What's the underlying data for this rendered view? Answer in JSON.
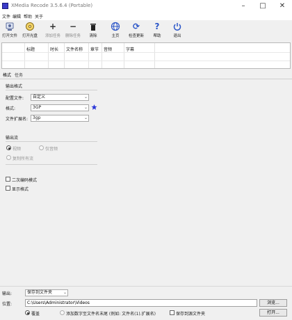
{
  "window": {
    "title": "XMedia Recode 3.5.6.4 (Portable)",
    "minimize": "–",
    "maximize": "□",
    "close": "✕"
  },
  "menu": [
    "文件",
    "编辑",
    "帮助",
    "关于"
  ],
  "toolbar": [
    {
      "label": "打开文件",
      "icon": "open-file-icon",
      "enabled": true
    },
    {
      "label": "打开光盘",
      "icon": "open-disc-icon",
      "enabled": true
    },
    {
      "label": "添加任务",
      "icon": "add-icon",
      "enabled": false
    },
    {
      "label": "删除任务",
      "icon": "remove-icon",
      "enabled": false
    },
    {
      "label": "清除",
      "icon": "trash-icon",
      "enabled": true
    },
    {
      "label": "主页",
      "icon": "globe-icon",
      "enabled": true
    },
    {
      "label": "检查更新",
      "icon": "refresh-icon",
      "enabled": true
    },
    {
      "label": "帮助",
      "icon": "help-icon",
      "enabled": true
    },
    {
      "label": "退出",
      "icon": "power-icon",
      "enabled": true
    }
  ],
  "file_list": {
    "columns": [
      "标题",
      "时长",
      "文件名称",
      "章节",
      "音频",
      "字幕"
    ]
  },
  "tabs": [
    "格式",
    "任务"
  ],
  "format_section": {
    "title": "输出格式",
    "fields": [
      {
        "label": "配置文件:",
        "value": "自定义",
        "favorite": false
      },
      {
        "label": "格式:",
        "value": "3GP",
        "favorite": true
      },
      {
        "label": "文件扩展名:",
        "value": "3gp",
        "favorite": false
      }
    ]
  },
  "output_section": {
    "title": "输出流",
    "options": [
      {
        "label": "视频",
        "selected": true
      },
      {
        "label": "仅音频",
        "selected": false
      },
      {
        "label": "复制所有流",
        "selected": false
      }
    ]
  },
  "extra_options": [
    {
      "label": "二次编码模式",
      "checked": false
    },
    {
      "label": "显示格式",
      "checked": false
    }
  ],
  "bottom": {
    "output_label": "输出:",
    "output_value": "保存到文件夹",
    "folder_label": "位置:",
    "folder_path": "C:\\Users\\Administrator\\Videos",
    "browse_button": "浏览...",
    "open_button": "打开...",
    "overwrite_label": "覆盖",
    "rename_label": "添加数字至文件名末尾 (例如: 文件名(1).扩展名)",
    "same_folder_label": "保存到源文件夹"
  },
  "colors": {
    "favorite_star": "#2b37d8",
    "accent_blue": "#2a55c8"
  }
}
